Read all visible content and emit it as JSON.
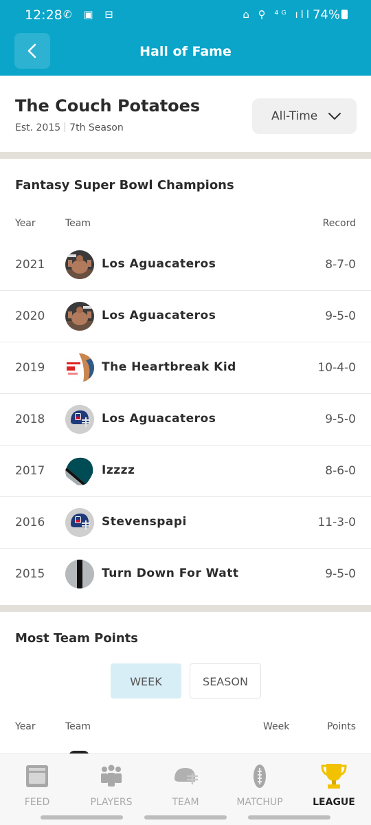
{
  "status_bar": {
    "time": "12:28",
    "left_icons": "✆ ▣ ⊟",
    "right_icons": "⌂ ⚲ ⁴ᴳ ıll",
    "battery": "74%"
  },
  "app_bar": {
    "title": "Hall of Fame"
  },
  "league": {
    "name": "The Couch Potatoes",
    "established": "Est. 2015",
    "season": "7th Season",
    "range_label": "All-Time"
  },
  "champions": {
    "title": "Fantasy Super Bowl Champions",
    "headers": {
      "year": "Year",
      "team": "Team",
      "record": "Record"
    },
    "rows": [
      {
        "year": "2021",
        "team": "Los Aguacateros",
        "record": "8-7-0",
        "avatar": "bodybuilder-photo"
      },
      {
        "year": "2020",
        "team": "Los Aguacateros",
        "record": "9-5-0",
        "avatar": "bodybuilder-photo"
      },
      {
        "year": "2019",
        "team": "The Heartbreak Kid",
        "record": "10-4-0",
        "avatar": "heartbreak-kid-photo"
      },
      {
        "year": "2018",
        "team": "Los Aguacateros",
        "record": "9-5-0",
        "avatar": "nfl-helmet"
      },
      {
        "year": "2017",
        "team": "Izzzz",
        "record": "8-6-0",
        "avatar": "green-helmet"
      },
      {
        "year": "2016",
        "team": "Stevenspapi",
        "record": "11-3-0",
        "avatar": "nfl-helmet"
      },
      {
        "year": "2015",
        "team": "Turn Down For Watt",
        "record": "9-5-0",
        "avatar": "silver-helmet"
      }
    ]
  },
  "most_points": {
    "title": "Most Team Points",
    "toggle": {
      "week": "WEEK",
      "season": "SEASON",
      "selected": "WEEK"
    },
    "headers": {
      "year": "Year",
      "team": "Team",
      "week": "Week",
      "points": "Points"
    }
  },
  "bottom_nav": {
    "items": [
      {
        "label": "FEED",
        "icon": "feed-icon"
      },
      {
        "label": "PLAYERS",
        "icon": "players-icon"
      },
      {
        "label": "TEAM",
        "icon": "helmet-icon"
      },
      {
        "label": "MATCHUP",
        "icon": "football-icon"
      },
      {
        "label": "LEAGUE",
        "icon": "trophy-icon"
      }
    ],
    "active": "LEAGUE"
  },
  "colors": {
    "brand": "#0aa5c9",
    "divider": "#e3e0d9",
    "trophy": "#f2c200",
    "week_selected": "#d8eef6"
  }
}
